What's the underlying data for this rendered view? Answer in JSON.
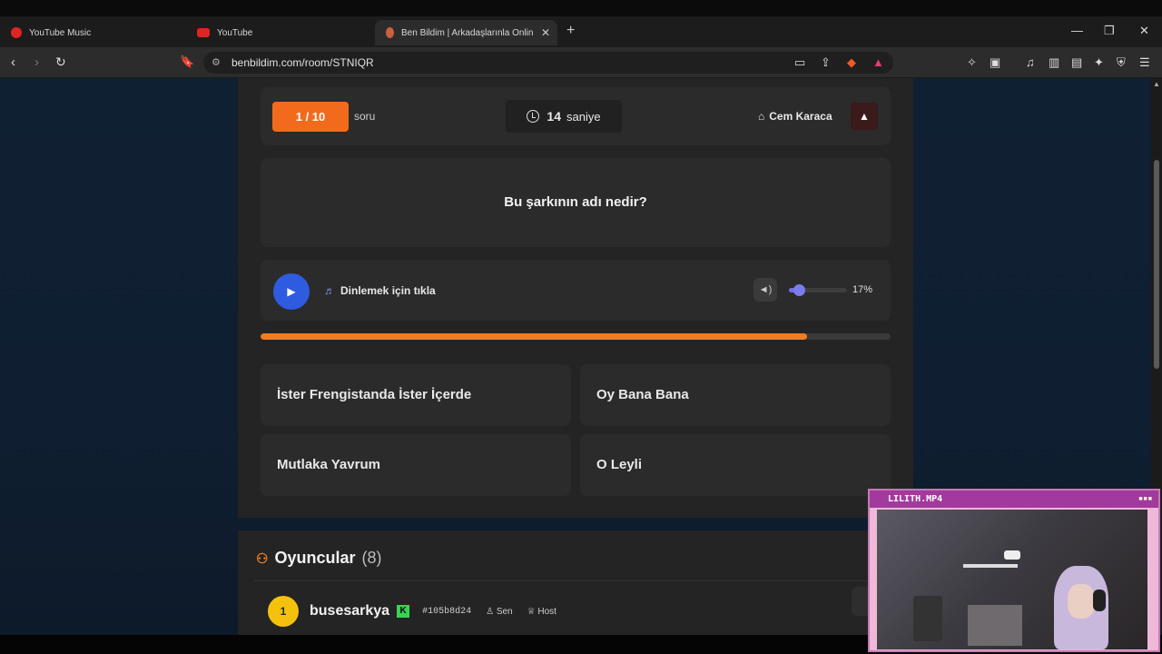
{
  "browser": {
    "tabs": [
      {
        "label": "YouTube Music",
        "icon": "youtube-music-icon"
      },
      {
        "label": "YouTube",
        "icon": "youtube-icon"
      },
      {
        "label": "Ben Bildim | Arkadaşlarınla Onlin",
        "icon": "benbildim-favicon"
      }
    ],
    "url": "benbildim.com/room/STNIQR"
  },
  "game": {
    "counter": "1 / 10",
    "counter_suffix": "soru",
    "timer_value": "14",
    "timer_unit": "saniye",
    "author": "Cem Karaca",
    "question": "Bu şarkının adı nedir?",
    "listen_label": "Dinlemek için tıkla",
    "volume_pct": "17%",
    "volume_fraction": 0.17,
    "progress_fraction": 0.867,
    "answers": [
      "İster Frengistanda İster İçerde",
      "Oy Bana Bana",
      "Mutlaka Yavrum",
      "O Leyli"
    ]
  },
  "players": {
    "title": "Oyuncular",
    "count": "(8)",
    "list": [
      {
        "rank": "1",
        "name": "busesarkya",
        "id": "#105b8d24",
        "tag_you": "Sen",
        "tag_host": "Host"
      }
    ]
  },
  "webcam": {
    "title": "LILITH.MP4"
  },
  "colors": {
    "accent_orange": "#f26b1d",
    "play_blue": "#2f5be0",
    "volume_purple": "#6e6eea"
  }
}
